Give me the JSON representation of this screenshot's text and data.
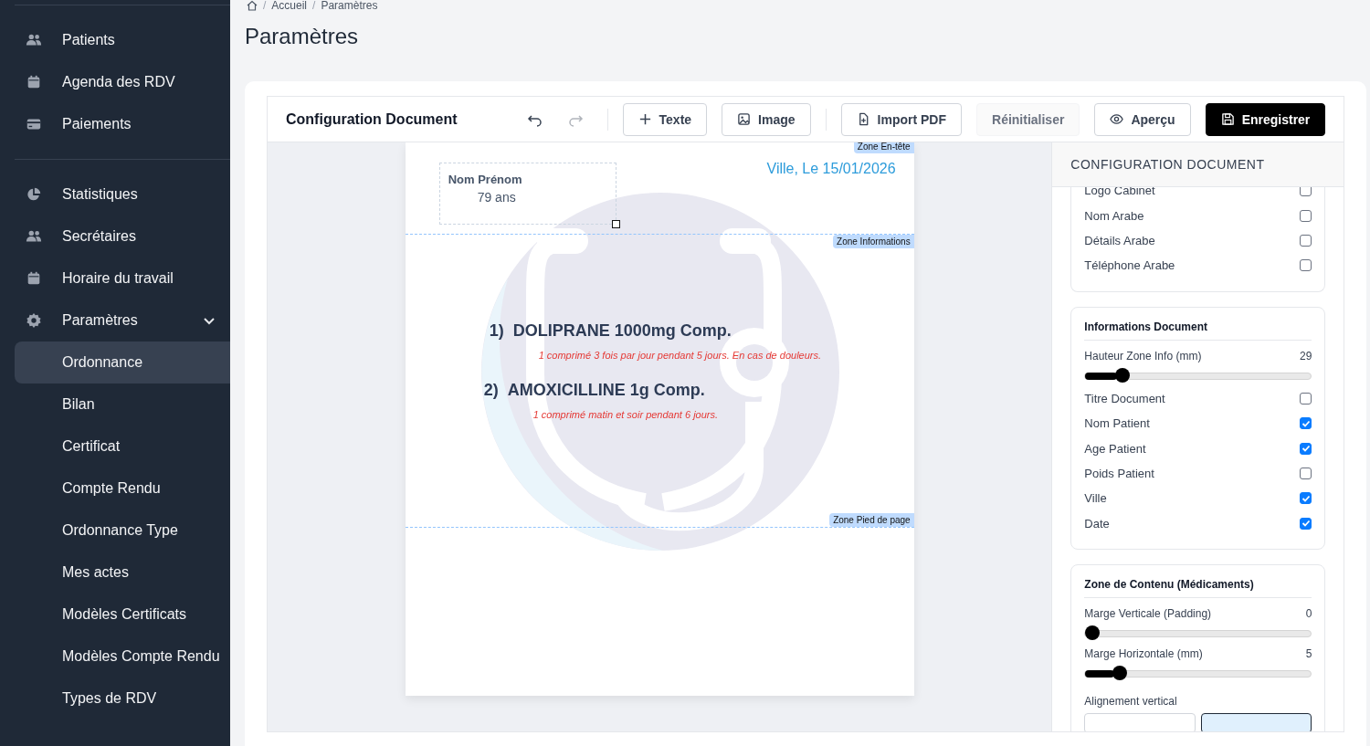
{
  "sidebar": {
    "groups": [
      {
        "items": [
          {
            "label": "Patients",
            "kind": "people"
          },
          {
            "label": "Agenda des RDV",
            "kind": "calendar"
          },
          {
            "label": "Paiements",
            "kind": "card"
          }
        ]
      },
      {
        "items": [
          {
            "label": "Statistiques",
            "kind": "chart"
          },
          {
            "label": "Secrétaires",
            "kind": "people"
          },
          {
            "label": "Horaire du travail",
            "kind": "calendar"
          },
          {
            "label": "Paramètres",
            "kind": "gear",
            "expanded": true,
            "children": [
              {
                "label": "Ordonnance",
                "selected": true
              },
              {
                "label": "Bilan",
                "selected": false
              },
              {
                "label": "Certificat",
                "selected": false
              },
              {
                "label": "Compte Rendu",
                "selected": false
              },
              {
                "label": "Ordonnance Type",
                "selected": false
              },
              {
                "label": "Mes actes",
                "selected": false
              },
              {
                "label": "Modèles Certificats",
                "selected": false
              },
              {
                "label": "Modèles Compte Rendu",
                "selected": false
              },
              {
                "label": "Types de RDV",
                "selected": false
              }
            ]
          }
        ]
      }
    ]
  },
  "breadcrumb": [
    {
      "kind": "separator",
      "text": "/"
    },
    {
      "kind": "link",
      "text": "Accueil"
    },
    {
      "kind": "separator",
      "text": "/"
    },
    {
      "kind": "link",
      "text": "Paramètres"
    }
  ],
  "page_title": "Paramètres",
  "editor": {
    "title": "Configuration Document",
    "history": [
      {
        "kind": "undo",
        "disabled": false
      },
      {
        "kind": "redo",
        "disabled": true
      }
    ],
    "buttons": [
      {
        "label": "Texte",
        "kind": "plus"
      },
      {
        "label": "Image",
        "kind": "image"
      },
      {
        "label": "Import PDF",
        "kind": "pdf"
      },
      {
        "label": "Réinitialiser",
        "kind": "reset"
      },
      {
        "label": "Aperçu",
        "kind": "eye"
      },
      {
        "label": "Enregistrer",
        "kind": "save"
      }
    ]
  },
  "document": {
    "zones": [
      "Zone En-tête",
      "Zone Informations",
      "Zone Pied de page"
    ],
    "patient_name": "Nom Prénom",
    "patient_age": "79 ans",
    "place_date": "Ville, Le 15/01/2026",
    "medications": [
      {
        "number": "1)",
        "name": "DOLIPRANE 1000mg Comp.",
        "dosage": "1 comprimé 3 fois par jour pendant 5 jours. En cas de douleurs."
      },
      {
        "number": "2)",
        "name": "AMOXICILLINE 1g Comp.",
        "dosage": "1 comprimé matin et soir pendant 6 jours."
      }
    ]
  },
  "config_panel": {
    "title": "CONFIGURATION DOCUMENT",
    "sections": [
      {
        "rows": [
          {
            "kind": "checkbox",
            "label": "Logo Cabinet",
            "checked": false
          },
          {
            "kind": "checkbox",
            "label": "Nom Arabe",
            "checked": false
          },
          {
            "kind": "checkbox",
            "label": "Détails Arabe",
            "checked": false
          },
          {
            "kind": "checkbox",
            "label": "Téléphone Arabe",
            "checked": false
          }
        ]
      },
      {
        "title": "Informations Document",
        "rows": [
          {
            "kind": "slider",
            "label": "Hauteur Zone Info (mm)",
            "value": "29",
            "level": 0.14
          },
          {
            "kind": "checkbox",
            "label": "Titre Document",
            "checked": false
          },
          {
            "kind": "checkbox",
            "label": "Nom Patient",
            "checked": true
          },
          {
            "kind": "checkbox",
            "label": "Age Patient",
            "checked": true
          },
          {
            "kind": "checkbox",
            "label": "Poids Patient",
            "checked": false
          },
          {
            "kind": "checkbox",
            "label": "Ville",
            "checked": true
          },
          {
            "kind": "checkbox",
            "label": "Date",
            "checked": true
          }
        ]
      },
      {
        "title": "Zone de Contenu (Médicaments)",
        "rows": [
          {
            "kind": "slider",
            "label": "Marge Verticale (Padding)",
            "value": "0",
            "level": 0
          },
          {
            "kind": "slider",
            "label": "Marge Horizontale (mm)",
            "value": "5",
            "level": 0.13
          },
          {
            "kind": "segmented",
            "label": "Alignement vertical",
            "options": [
              {
                "selected": false
              },
              {
                "selected": true
              }
            ]
          }
        ]
      }
    ]
  }
}
